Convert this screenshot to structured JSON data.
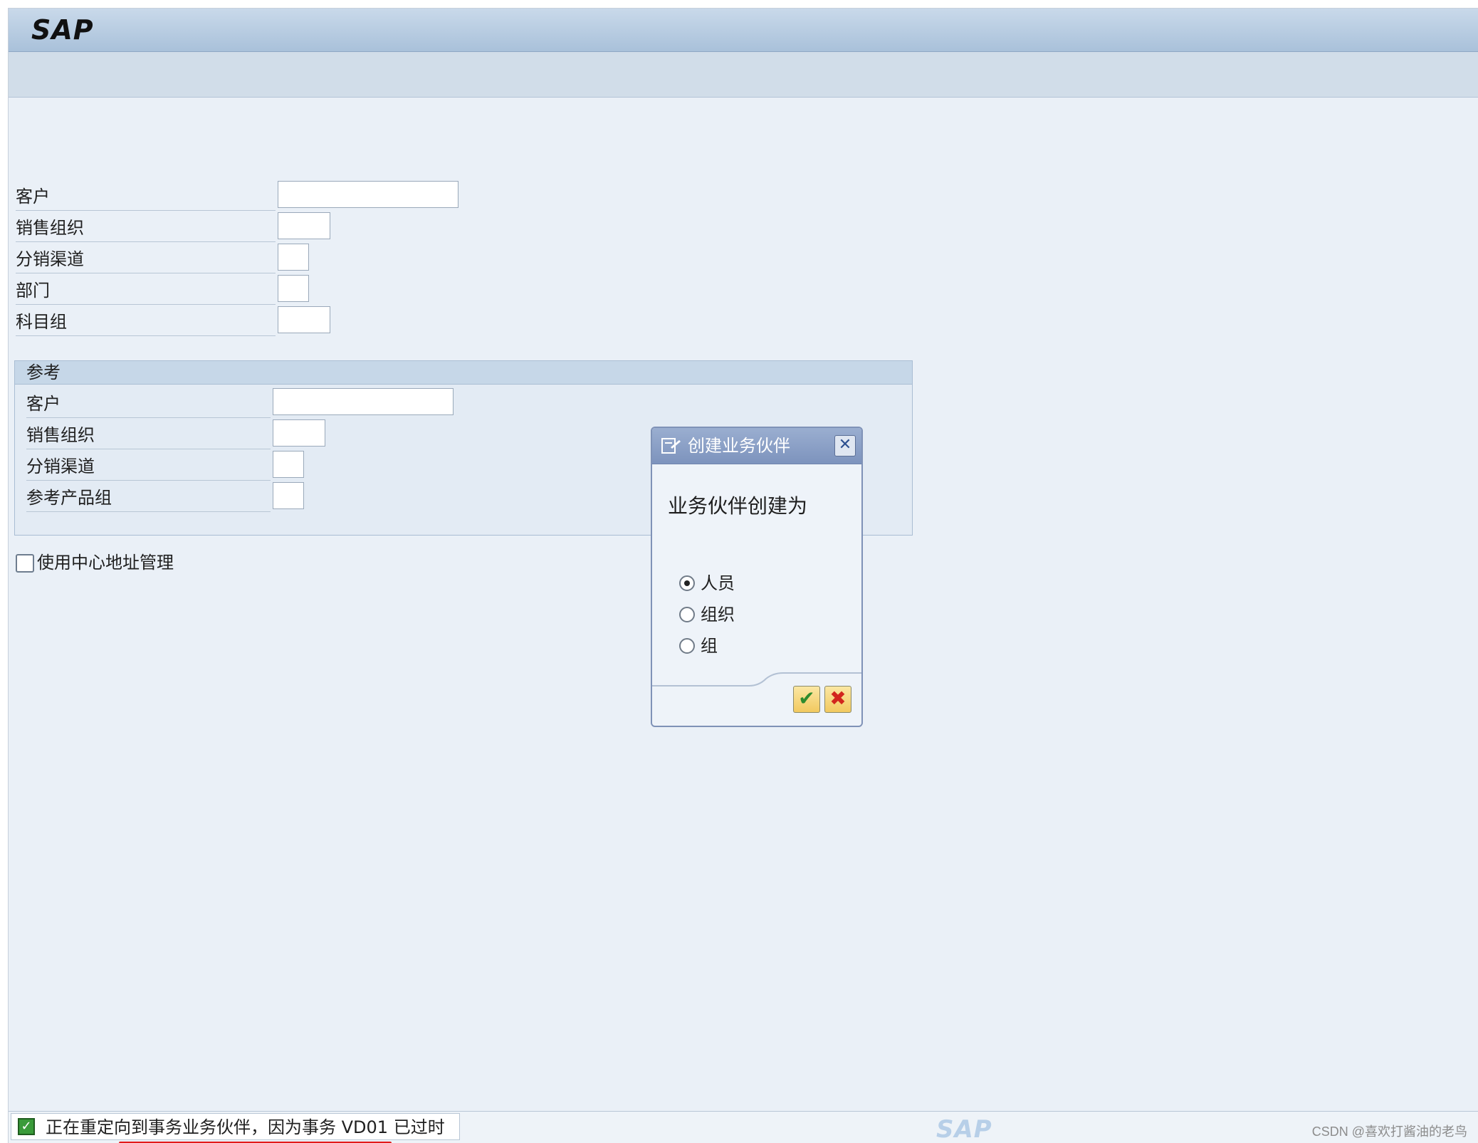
{
  "app": {
    "logo": "SAP"
  },
  "fields": [
    {
      "label": "客户",
      "value": ""
    },
    {
      "label": "销售组织",
      "value": ""
    },
    {
      "label": "分销渠道",
      "value": ""
    },
    {
      "label": "部门",
      "value": ""
    },
    {
      "label": "科目组",
      "value": ""
    }
  ],
  "reference": {
    "title": "参考",
    "fields": [
      {
        "label": "客户",
        "value": ""
      },
      {
        "label": "销售组织",
        "value": ""
      },
      {
        "label": "分销渠道",
        "value": ""
      },
      {
        "label": "参考产品组",
        "value": ""
      }
    ]
  },
  "checkbox": {
    "label": "使用中心地址管理",
    "checked": false
  },
  "dialog": {
    "title": "创建业务伙伴",
    "close_icon": "close-icon",
    "prompt": "业务伙伴创建为",
    "options": [
      {
        "label": "人员",
        "selected": true
      },
      {
        "label": "组织",
        "selected": false
      },
      {
        "label": "组",
        "selected": false
      }
    ],
    "confirm_icon": "checkmark-icon",
    "cancel_icon": "cancel-icon"
  },
  "status": {
    "icon": "success-icon",
    "message": "正在重定向到事务业务伙伴，因为事务 VD01 已过时",
    "brand": "SAP"
  },
  "watermark": "CSDN @喜欢打酱油的老鸟",
  "colors": {
    "accent": "#7d93bd",
    "underline": "#e21b1b",
    "success": "#3a9b3a"
  }
}
